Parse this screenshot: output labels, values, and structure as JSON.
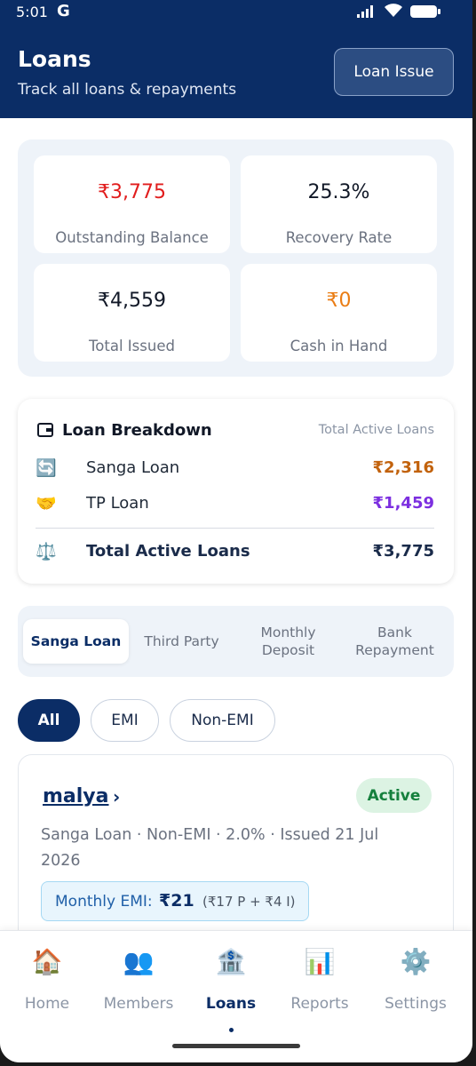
{
  "status_bar": {
    "time": "5:01",
    "g_label": "G"
  },
  "header": {
    "title": "Loans",
    "subtitle": "Track all loans & repayments",
    "issue_button": "Loan Issue"
  },
  "stats": [
    {
      "value": "₹3,775",
      "label": "Outstanding Balance",
      "color": "#e11d1d"
    },
    {
      "value": "25.3%",
      "label": "Recovery Rate",
      "color": "#111827"
    },
    {
      "value": "₹4,559",
      "label": "Total Issued",
      "color": "#111827"
    },
    {
      "value": "₹0",
      "label": "Cash in Hand",
      "color": "#ea7d14"
    }
  ],
  "breakdown": {
    "title": "Loan Breakdown",
    "subtitle": "Total Active Loans",
    "rows": [
      {
        "icon": "🔄",
        "icon_name": "refresh-icon",
        "name": "Sanga Loan",
        "amount": "₹2,316",
        "color": "#c2620c"
      },
      {
        "icon": "🤝",
        "icon_name": "handshake-icon",
        "name": "TP Loan",
        "amount": "₹1,459",
        "color": "#7c2fe0"
      }
    ],
    "total": {
      "icon": "⚖️",
      "icon_name": "scale-icon",
      "name": "Total Active Loans",
      "amount": "₹3,775"
    }
  },
  "tabs": [
    {
      "label": "Sanga Loan",
      "active": true
    },
    {
      "label": "Third Party",
      "active": false
    },
    {
      "label": "Monthly Deposit",
      "line1": "Monthly",
      "line2": "Deposit",
      "active": false
    },
    {
      "label": "Bank Repayment",
      "line1": "Bank",
      "line2": "Repayment",
      "active": false
    }
  ],
  "filters": [
    {
      "label": "All",
      "active": true
    },
    {
      "label": "EMI",
      "active": false
    },
    {
      "label": "Non-EMI",
      "active": false
    }
  ],
  "loan_card": {
    "name": "malya",
    "status": "Active",
    "meta": "Sanga Loan · Non-EMI · 2.0% · Issued 21 Jul 2026",
    "emi_label": "Monthly EMI:",
    "emi_amount": "₹21",
    "emi_detail": "(₹17 P + ₹4 I)"
  },
  "bottom_nav": [
    {
      "label": "Home",
      "icon": "🏠",
      "icon_name": "home-icon",
      "active": false
    },
    {
      "label": "Members",
      "icon": "👥",
      "icon_name": "members-icon",
      "active": false
    },
    {
      "label": "Loans",
      "icon": "🏦",
      "icon_name": "bank-icon",
      "active": true
    },
    {
      "label": "Reports",
      "icon": "📊",
      "icon_name": "chart-icon",
      "active": false
    },
    {
      "label": "Settings",
      "icon": "⚙️",
      "icon_name": "gear-icon",
      "active": false
    }
  ],
  "colors": {
    "primary": "#0b2d66",
    "active_badge_bg": "#dcf3e3",
    "active_badge_text": "#15803d"
  }
}
